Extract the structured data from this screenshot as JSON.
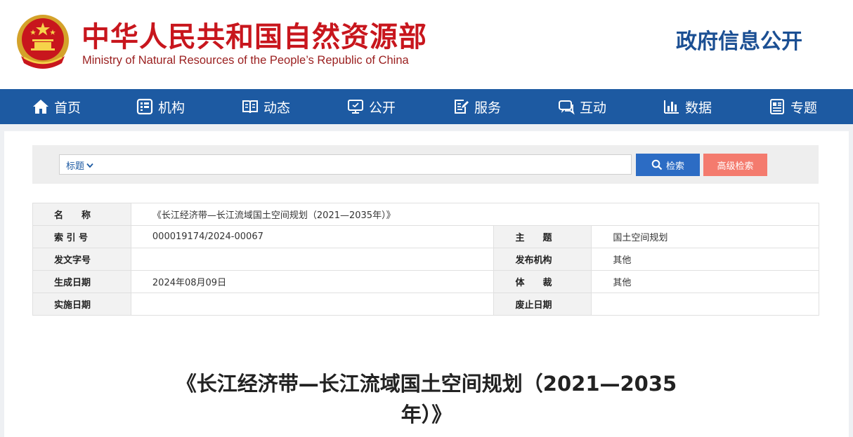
{
  "header": {
    "ministry_cn": "中华人民共和国自然资源部",
    "ministry_en": "Ministry of Natural Resources of the People’s Republic of China",
    "section": "政府信息公开"
  },
  "nav": {
    "items": [
      {
        "label": "首页",
        "icon": "home-icon"
      },
      {
        "label": "机构",
        "icon": "org-icon"
      },
      {
        "label": "动态",
        "icon": "book-icon"
      },
      {
        "label": "公开",
        "icon": "monitor-icon"
      },
      {
        "label": "服务",
        "icon": "edit-doc-icon"
      },
      {
        "label": "互动",
        "icon": "chat-icon"
      },
      {
        "label": "数据",
        "icon": "bar-chart-icon"
      },
      {
        "label": "专题",
        "icon": "document-icon"
      }
    ]
  },
  "search": {
    "type_label": "标题",
    "query": "",
    "search_label": "检索",
    "advanced_label": "高级检索"
  },
  "meta": {
    "name_key": "名　　称",
    "name_value": "《长江经济带—长江流域国土空间规划（2021—2035年）》",
    "index_key": "索 引 号",
    "index_value": "000019174/2024-00067",
    "topic_key": "主　　题",
    "topic_value": "国土空间规划",
    "docno_key": "发文字号",
    "docno_value": "",
    "publisher_key": "发布机构",
    "publisher_value": "其他",
    "created_key": "生成日期",
    "created_value": "2024年08月09日",
    "genre_key": "体　　裁",
    "genre_value": "其他",
    "effective_key": "实施日期",
    "effective_value": "",
    "expire_key": "废止日期",
    "expire_value": ""
  },
  "document": {
    "title_line1": "《长江经济带—长江流域国土空间规划（2021—2035",
    "title_line2": "年）》"
  },
  "colors": {
    "brand_red": "#c8161d",
    "nav_blue": "#1d5aa2",
    "search_blue": "#2c6cc4",
    "advanced_salmon": "#f47b6e"
  }
}
